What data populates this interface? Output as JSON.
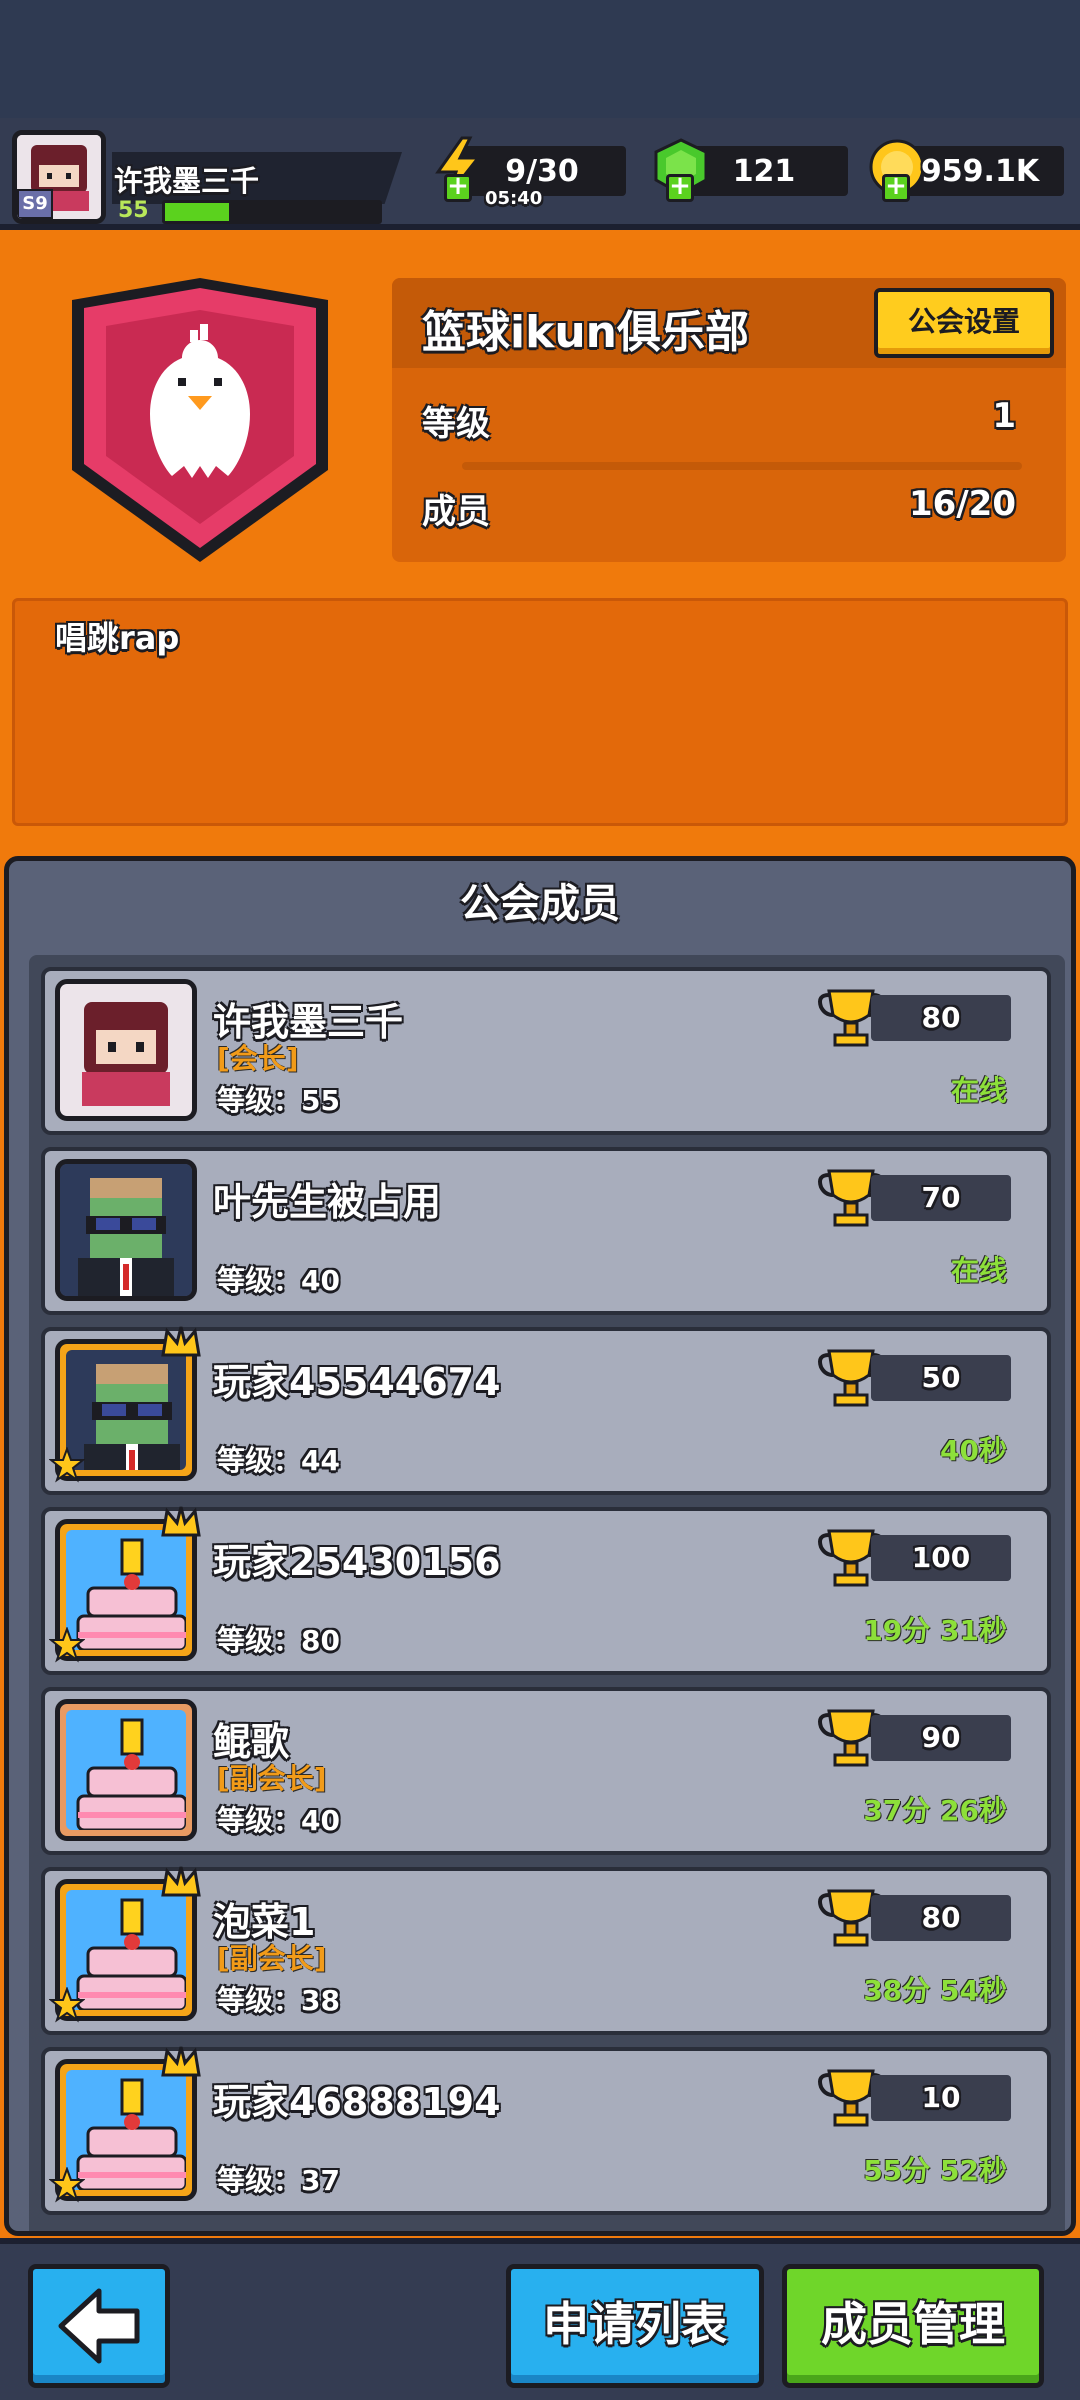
{
  "player": {
    "name": "许我墨三千",
    "level": "55",
    "xp_fraction": 0.3,
    "avatar_tag": "S9"
  },
  "resources": {
    "energy": {
      "value": "9/30",
      "timer": "05:40",
      "icon": "lightning-icon"
    },
    "gems": {
      "value": "121",
      "icon": "green-gem-icon"
    },
    "coins": {
      "value": "959.1K",
      "icon": "gold-coin-icon"
    }
  },
  "guild": {
    "name": "篮球ikun俱乐部",
    "settings_label": "公会设置",
    "level_label": "等级",
    "level_value": "1",
    "members_label": "成员",
    "members_value": "16/20",
    "motto": "唱跳rap",
    "badge_icon": "chicken-shield-icon"
  },
  "members_panel": {
    "title": "公会成员",
    "members": [
      {
        "name": "许我墨三千",
        "title": "[会长]",
        "level_text": "等级：55",
        "trophies": "80",
        "status": "在线",
        "avatar": "player-girl",
        "frame": "plain"
      },
      {
        "name": "叶先生被占用",
        "title": "",
        "level_text": "等级：40",
        "trophies": "70",
        "status": "在线",
        "avatar": "zombie",
        "frame": "plain"
      },
      {
        "name": "玩家45544674",
        "title": "",
        "level_text": "等级：44",
        "trophies": "50",
        "status": "40秒",
        "avatar": "zombie",
        "frame": "gold"
      },
      {
        "name": "玩家25430156",
        "title": "",
        "level_text": "等级：80",
        "trophies": "100",
        "status": "19分 31秒",
        "avatar": "cake",
        "frame": "gold"
      },
      {
        "name": "鲲歌",
        "title": "[副会长]",
        "level_text": "等级：40",
        "trophies": "90",
        "status": "37分 26秒",
        "avatar": "cake",
        "frame": "bronze"
      },
      {
        "name": "泡菜1",
        "title": "[副会长]",
        "level_text": "等级：38",
        "trophies": "80",
        "status": "38分 54秒",
        "avatar": "cake",
        "frame": "gold"
      },
      {
        "name": "玩家46888194",
        "title": "",
        "level_text": "等级：37",
        "trophies": "10",
        "status": "55分 52秒",
        "avatar": "cake",
        "frame": "gold"
      }
    ]
  },
  "bottom": {
    "back_icon": "back-arrow-icon",
    "apply_label": "申请列表",
    "manage_label": "成员管理"
  },
  "colors": {
    "orange": "#f07a0c",
    "panel": "#5a6278",
    "green_status": "#8de03a",
    "blue_button": "#28b0ef",
    "green_button": "#6fd62a"
  }
}
